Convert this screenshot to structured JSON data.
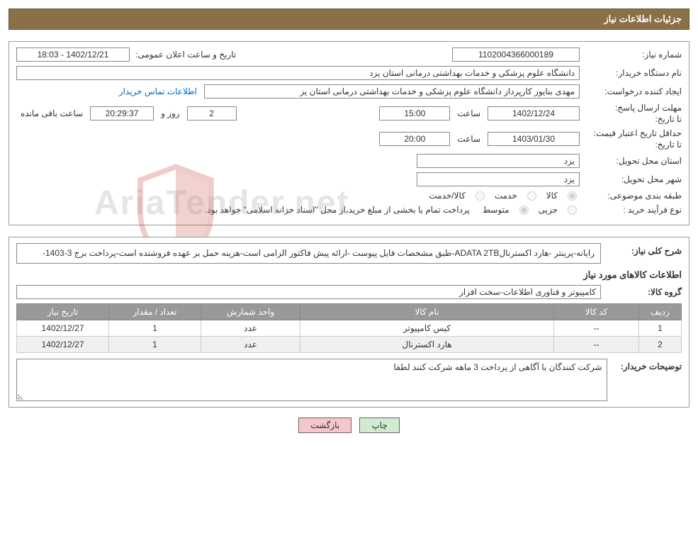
{
  "header": {
    "title": "جزئیات اطلاعات نیاز"
  },
  "panel1": {
    "req_no_label": "شماره نیاز:",
    "req_no": "1102004366000189",
    "announce_label": "تاریخ و ساعت اعلان عمومی:",
    "announce_val": "1402/12/21 - 18:03",
    "buyer_label": "نام دستگاه خریدار:",
    "buyer_val": "دانشگاه علوم پزشکی و خدمات بهداشتی  درمانی استان یزد",
    "creator_label": "ایجاد کننده درخواست:",
    "creator_val": "مهدی بنایور کارپرداز دانشگاه علوم پزشکی و خدمات بهداشتی  درمانی استان یز",
    "contact_link": "اطلاعات تماس خریدار",
    "deadline_label1": "مهلت ارسال پاسخ:",
    "deadline_label2": "تا تاریخ:",
    "deadline_date": "1402/12/24",
    "time_label": "ساعت",
    "deadline_time": "15:00",
    "days_val": "2",
    "days_label": "روز و",
    "timer_val": "20:29:37",
    "remain_label": "ساعت باقی مانده",
    "validity_label1": "حداقل تاریخ اعتبار قیمت:",
    "validity_label2": "تا تاریخ:",
    "validity_date": "1403/01/30",
    "validity_time": "20:00",
    "province_label": "استان محل تحویل:",
    "province_val": "یزد",
    "city_label": "شهر محل تحویل:",
    "city_val": "یزد",
    "category_label": "طبقه بندی موضوعی:",
    "cat_opt1": "کالا",
    "cat_opt2": "خدمت",
    "cat_opt3": "کالا/خدمت",
    "proc_label": "نوع فرآیند خرید :",
    "proc_opt1": "جزیی",
    "proc_opt2": "متوسط",
    "proc_note": "پرداخت تمام یا بخشی از مبلغ خرید،از محل \"اسناد خزانه اسلامی\" خواهد بود."
  },
  "panel2": {
    "desc_label": "شرح کلی نیاز:",
    "desc_val": "رایانه-پرینتر -هارد اکسترنالADATA 2TB-طبق مشخصات فایل پیوست -ارائه پیش فاکتور الزامی است-هزینه حمل بر عهده فروشنده است-پرداخت برج 3-1403-",
    "items_title": "اطلاعات کالاهای مورد نیاز",
    "group_label": "گروه کالا:",
    "group_val": "کامپیوتر و فناوری اطلاعات-سخت افزار",
    "cols": {
      "row": "ردیف",
      "code": "کد کالا",
      "name": "نام کالا",
      "unit": "واحد شمارش",
      "qty": "تعداد / مقدار",
      "date": "تاریخ نیاز"
    },
    "rows": [
      {
        "row": "1",
        "code": "--",
        "name": "کیس کامپیوتر",
        "unit": "عدد",
        "qty": "1",
        "date": "1402/12/27"
      },
      {
        "row": "2",
        "code": "--",
        "name": "هارد اکسترنال",
        "unit": "عدد",
        "qty": "1",
        "date": "1402/12/27"
      }
    ],
    "buyer_notes_label": "توضیحات خریدار:",
    "buyer_notes_val": "شرکت کنندگان با آگاهی از پرداخت 3 ماهه شرکت کنند لطفا"
  },
  "buttons": {
    "print": "چاپ",
    "back": "بازگشت"
  },
  "watermark": {
    "text": "AriaTender.net"
  },
  "chart_data": {
    "type": "table",
    "title": "اطلاعات کالاهای مورد نیاز",
    "columns": [
      "ردیف",
      "کد کالا",
      "نام کالا",
      "واحد شمارش",
      "تعداد / مقدار",
      "تاریخ نیاز"
    ],
    "rows": [
      [
        "1",
        "--",
        "کیس کامپیوتر",
        "عدد",
        "1",
        "1402/12/27"
      ],
      [
        "2",
        "--",
        "هارد اکسترنال",
        "عدد",
        "1",
        "1402/12/27"
      ]
    ]
  }
}
